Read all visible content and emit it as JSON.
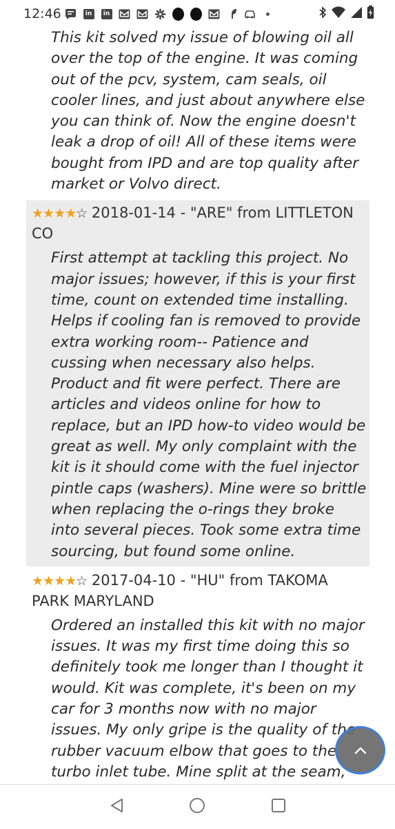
{
  "status_bar": {
    "time": "12:46",
    "notification_icons": [
      "message-icon",
      "linkedin-icon",
      "linkedin-icon",
      "gmail-icon",
      "gmail-icon",
      "slack-icon",
      "app-dot-icon",
      "app-dot-icon",
      "gmail-icon",
      "sprout-icon",
      "car-icon",
      "more-dot-icon"
    ],
    "system_icons": [
      "bluetooth-icon",
      "wifi-icon",
      "signal-icon",
      "battery-charging-icon"
    ]
  },
  "reviews": [
    {
      "text": "This kit solved my issue of blowing oil all over the top of the engine. It was coming out of the pcv, system, cam seals, oil cooler lines, and just about anywhere else you can think of. Now the engine doesn't leak a drop of oil! All of these items were bought from IPD and are top quality after market or Volvo direct."
    },
    {
      "rating": 4,
      "stars_filled": "★★★★",
      "stars_empty": "☆",
      "header": "2018-01-14 - \"ARE\" from LITTLETON CO",
      "text": "First attempt at tackling this project. No major issues; however, if this is your first time, count on extended time installing. Helps if cooling fan is removed to provide extra working room-- Patience and cussing when necessary also helps. Product and fit were perfect. There are articles and videos online for how to replace, but an IPD how-to video would be great as well. My only complaint with the kit is it should come with the fuel injector pintle caps (washers). Mine were so brittle when replacing the o-rings they broke into several pieces. Took some extra time sourcing, but found some online."
    },
    {
      "rating": 4,
      "stars_filled": "★★★★",
      "stars_empty": "☆",
      "header": "2017-04-10 - \"HU\" from TAKOMA PARK MARYLAND",
      "text": "Ordered an installed this kit with no major issues. It was my first time doing this so definitely took me longer than I thought it would. Kit was complete, it's been on my car for 3 months now with no major issues. My only gripe is the quality of the rubber vacuum elbow that goes to the turbo inlet tube. Mine split at the seam, cheap fix."
    }
  ],
  "controls": {
    "scroll_top_icon": "chevron-up-icon",
    "nav": [
      "back-icon",
      "home-icon",
      "recents-icon"
    ]
  },
  "colors": {
    "star": "#f0a020",
    "shaded_review_bg": "#ececec",
    "scroll_button_bg": "#696969",
    "scroll_button_ring": "#3f7fd6"
  }
}
